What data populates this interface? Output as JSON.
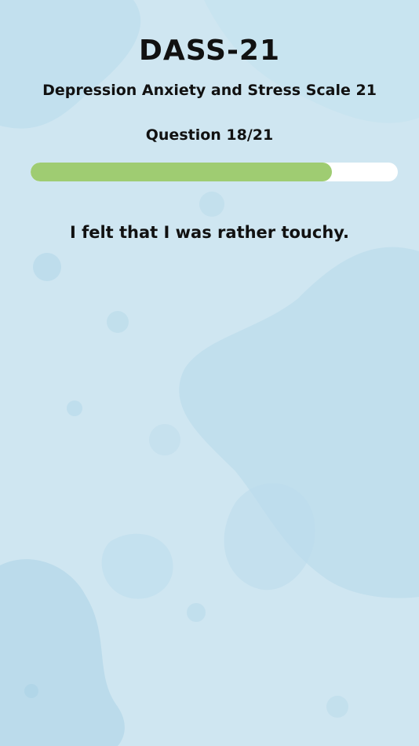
{
  "header": {
    "title": "DASS-21",
    "subtitle": "Depression Anxiety and Stress Scale 21"
  },
  "progress": {
    "label": "Question 18/21",
    "current": 18,
    "total": 21,
    "fraction": 0.82
  },
  "question": {
    "text": "I felt that I was rather touchy."
  },
  "colors": {
    "background": "#cfe6f1",
    "progress_fill": "#9fcc72",
    "progress_track": "#ffffff",
    "text": "#111111"
  }
}
